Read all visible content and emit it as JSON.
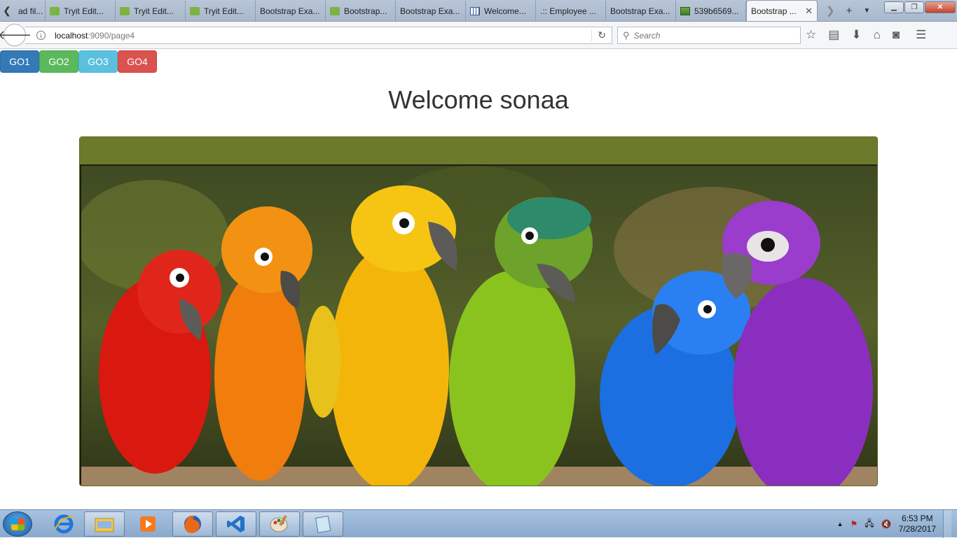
{
  "browser": {
    "tabs": [
      {
        "label": "ad fil...",
        "icon": "none"
      },
      {
        "label": "Tryit Edit...",
        "icon": "w3-icon"
      },
      {
        "label": "Tryit Edit...",
        "icon": "w3-icon"
      },
      {
        "label": "Tryit Edit...",
        "icon": "w3-icon"
      },
      {
        "label": "Bootstrap Exa...",
        "icon": "none"
      },
      {
        "label": "Bootstrap...",
        "icon": "w3-icon"
      },
      {
        "label": "Bootstrap Exa...",
        "icon": "none"
      },
      {
        "label": "Welcome...",
        "icon": "table-icon"
      },
      {
        "label": ".:: Employee ...",
        "icon": "none"
      },
      {
        "label": "Bootstrap Exa...",
        "icon": "none"
      },
      {
        "label": "539b6569...",
        "icon": "image-icon"
      }
    ],
    "active_tab": {
      "label": "Bootstrap ...",
      "close": "✕"
    },
    "url": {
      "host": "localhost",
      "rest": ":9090/page4"
    },
    "search": {
      "placeholder": "Search"
    }
  },
  "page": {
    "buttons": [
      {
        "label": "GO1",
        "color": "#337ab7"
      },
      {
        "label": "GO2",
        "color": "#5cb85c"
      },
      {
        "label": "GO3",
        "color": "#5bc0de"
      },
      {
        "label": "GO4",
        "color": "#d9534f"
      }
    ],
    "heading": "Welcome sonaa",
    "panel_heading_color": "#6b7a2b",
    "image_subject": "six colorful parrots perched on a branch"
  },
  "taskbar": {
    "apps": [
      "internet-explorer-icon",
      "file-explorer-icon",
      "media-player-icon",
      "firefox-icon",
      "visual-studio-icon",
      "paint-icon",
      "notepad-icon"
    ],
    "clock": {
      "time": "6:53 PM",
      "date": "7/28/2017"
    }
  }
}
